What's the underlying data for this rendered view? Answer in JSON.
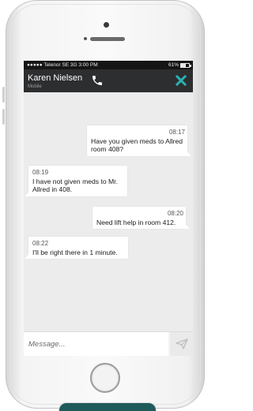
{
  "status_bar": {
    "carrier": "●●●●● Telenor SE  3G  3:00 PM",
    "battery": "61%",
    "battery_level": 0.61
  },
  "header": {
    "contact_name": "Karen Nielsen",
    "subtitle": "Mobile",
    "call_icon": "phone-icon",
    "close_icon": "close-icon",
    "accent_color": "#2bb1b3"
  },
  "messages": [
    {
      "direction": "out",
      "time": "08:17",
      "text": "Have you given meds to Allred room 408?"
    },
    {
      "direction": "in",
      "time": "08:19",
      "text": "I have not given meds to Mr. Allred in 408."
    },
    {
      "direction": "out",
      "time": "08:20",
      "text": "Need lift help in room 412."
    },
    {
      "direction": "in",
      "time": "08:22",
      "text": "I'll be right there in 1 minute."
    }
  ],
  "composer": {
    "placeholder": "Message...",
    "send_icon": "send-icon"
  }
}
